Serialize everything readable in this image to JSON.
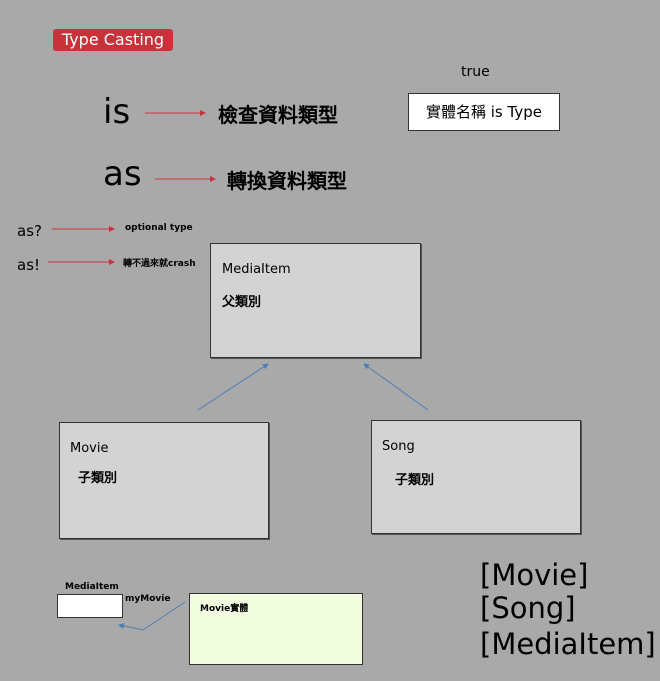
{
  "title": "Type Casting",
  "is_row": {
    "keyword": "is",
    "description": "檢查資料類型"
  },
  "as_row": {
    "keyword": "as",
    "description": "轉換資料類型"
  },
  "example": {
    "result": "true",
    "expression": "實體名稱 is Type"
  },
  "as_optional": {
    "keyword": "as?",
    "description": "optional type"
  },
  "as_forced": {
    "keyword": "as!",
    "description": "轉不過來就crash"
  },
  "parent_class": {
    "name": "MediaItem",
    "role": "父類別"
  },
  "child_movie": {
    "name": "Movie",
    "role": "子類別"
  },
  "child_song": {
    "name": "Song",
    "role": "子類別"
  },
  "variable": {
    "type_label": "MediaItem",
    "name": "myMovie"
  },
  "instance": {
    "label": "Movie實體"
  },
  "type_list": [
    "[Movie]",
    "[Song]",
    "[MediaItem]"
  ],
  "colors": {
    "background": "#a9a9a9",
    "badge": "#c8323a",
    "red_arrow": "#c8323a",
    "blue_arrow": "#4a7fb5",
    "class_box": "#d3d3d3",
    "instance_box": "#f2fde0"
  }
}
